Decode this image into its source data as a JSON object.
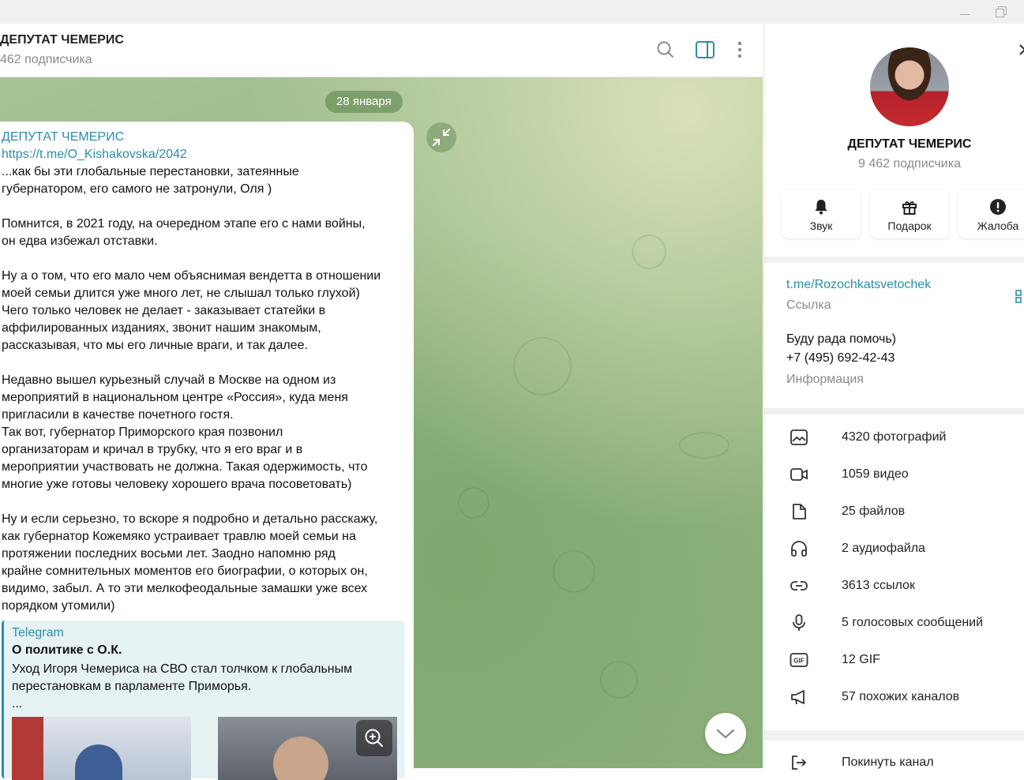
{
  "window": {
    "minimize_icon": "minimize-icon",
    "maximize_icon": "restore-icon"
  },
  "chat": {
    "title": "ДЕПУТАТ ЧЕМЕРИС",
    "subtitle": "462 подписчика",
    "date_pill": "28 января"
  },
  "message": {
    "author": "ДЕПУТАТ ЧЕМЕРИС",
    "link": "https://t.me/O_Kishakovska/2042",
    "text": "...как бы эти глобальные перестановки, затеянные\nгубернатором, его самого не затронули, Оля )\n\nПомнится, в 2021 году, на очередном этапе его с нами войны,\nон едва избежал отставки.\n\nНу а о том, что его мало чем объяснимая вендетта в отношении\nмоей семьи длится уже много лет, не слышал только глухой)\nЧего только человек не делает - заказывает статейки в\nаффилированных изданиях, звонит нашим знакомым,\nрассказывая, что мы его личные враги, и так далее.\n\nНедавно вышел курьезный случай в Москве на одном из\nмероприятий в национальном центре «Россия», куда меня\nпригласили в качестве почетного гостя.\nТак вот, губернатор Приморского края позвонил\nорганизаторам и кричал в трубку, что я его враг и в\nмероприятии участвовать не должна. Такая одержимость, что\nмногие уже готовы человеку хорошего врача посоветовать)\n\nНу и если серьезно, то вскоре я подробно и детально расскажу,\nкак губернатор Кожемяко устраивает травлю моей семьи на\nпротяжении последних восьми лет. Заодно напомню ряд\nкрайне сомнительных моментов его биографии, о которых он,\nвидимо, забыл. А то эти мелкофеодальные замашки уже всех\nпорядком утомили)",
    "preview": {
      "site": "Telegram",
      "title": "О политике с О.К.",
      "description": "Уход Игоря Чемериса на СВО стал толчком к глобальным перестановкам в парламенте Приморья.",
      "ellipsis": "..."
    }
  },
  "profile": {
    "name": "ДЕПУТАТ ЧЕМЕРИС",
    "subscribers": "9 462 подписчика",
    "actions": [
      {
        "label": "Звук",
        "icon": "bell-icon"
      },
      {
        "label": "Подарок",
        "icon": "gift-icon"
      },
      {
        "label": "Жалоба",
        "icon": "report-icon"
      }
    ],
    "link": "t.me/Rozochkatsvetochek",
    "link_caption": "Ссылка",
    "info_line1": "Буду рада помочь)",
    "info_line2": "+7 (495) 692-42-43",
    "info_caption": "Информация",
    "media": [
      {
        "label": "4320 фотографий",
        "icon": "photo-icon"
      },
      {
        "label": "1059 видео",
        "icon": "video-icon"
      },
      {
        "label": "25 файлов",
        "icon": "file-icon"
      },
      {
        "label": "2 аудиофайла",
        "icon": "headphones-icon"
      },
      {
        "label": "3613 ссылок",
        "icon": "link-icon"
      },
      {
        "label": "5 голосовых сообщений",
        "icon": "microphone-icon"
      },
      {
        "label": "12 GIF",
        "icon": "gif-icon"
      },
      {
        "label": "57 похожих каналов",
        "icon": "megaphone-icon"
      }
    ],
    "leave": "Покинуть канал"
  },
  "colors": {
    "accent": "#2a8ea8",
    "chat_bg": "#8fb37f",
    "muted_text": "#8a8a8a"
  }
}
